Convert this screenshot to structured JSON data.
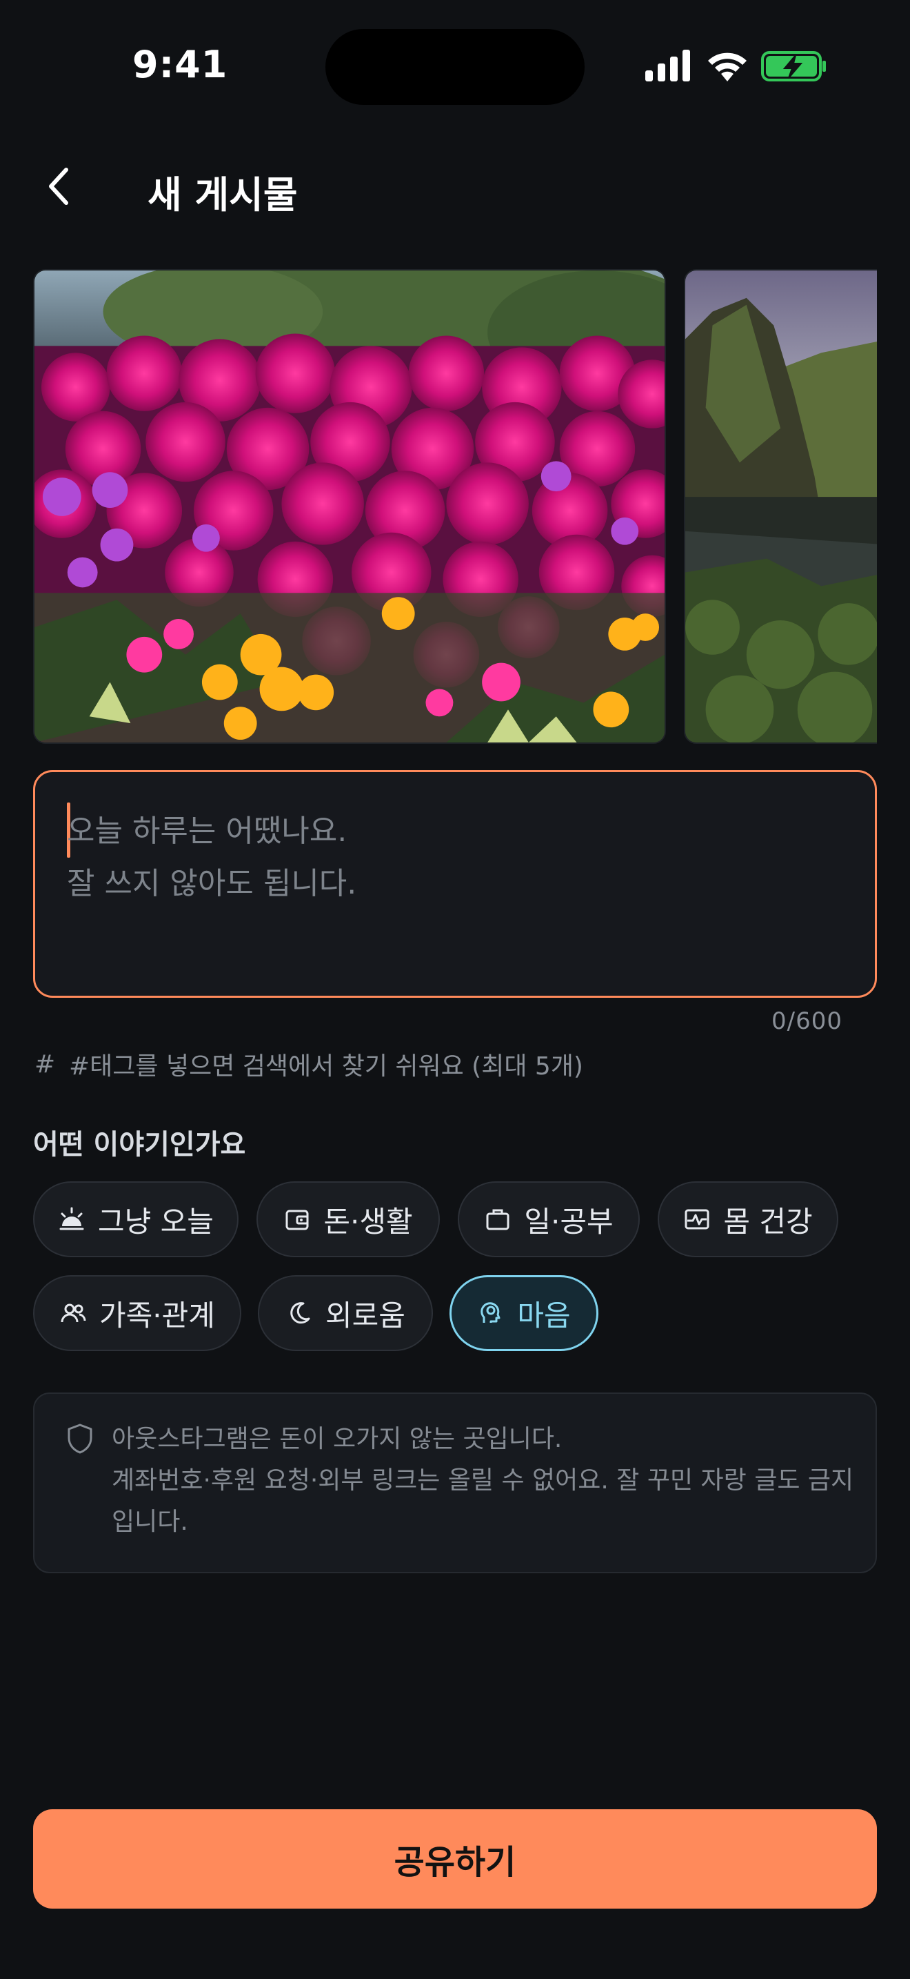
{
  "status_bar": {
    "time": "9:41"
  },
  "header": {
    "title": "새 게시물"
  },
  "compose": {
    "placeholder": "오늘 하루는 어땠나요.\n잘 쓰지 않아도 됩니다.",
    "counter": "0/600"
  },
  "tags": {
    "hint": "#태그를 넣으면 검색에서 찾기 쉬워요 (최대 5개)"
  },
  "category": {
    "label": "어떤 이야기인가요",
    "chips": [
      {
        "label": "그냥 오늘",
        "icon": "sunrise-icon",
        "selected": false
      },
      {
        "label": "돈·생활",
        "icon": "wallet-icon",
        "selected": false
      },
      {
        "label": "일·공부",
        "icon": "briefcase-icon",
        "selected": false
      },
      {
        "label": "몸 건강",
        "icon": "heartbeat-icon",
        "selected": false
      },
      {
        "label": "가족·관계",
        "icon": "people-icon",
        "selected": false
      },
      {
        "label": "외로움",
        "icon": "moon-icon",
        "selected": false
      },
      {
        "label": "마음",
        "icon": "mind-icon",
        "selected": true
      }
    ]
  },
  "notice": {
    "line1": "아웃스타그램은 돈이 오가지 않는 곳입니다.",
    "line2": "계좌번호·후원 요청·외부 링크는 올릴 수 없어요. 잘 꾸민 자랑 글도 금지입니다."
  },
  "share_button": {
    "label": "공유하기"
  },
  "colors": {
    "accent": "#ff8a5b",
    "selected_chip": "#7fd3ee",
    "background": "#0f1114"
  }
}
